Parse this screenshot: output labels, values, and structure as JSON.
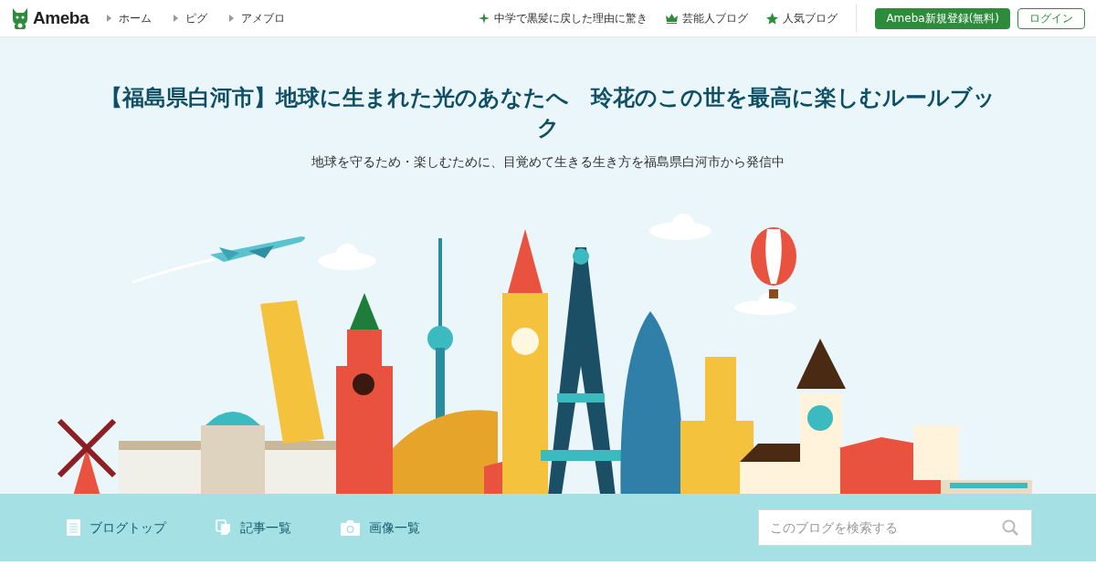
{
  "header": {
    "logo": "Ameba",
    "nav_links": [
      "ホーム",
      "ピグ",
      "アメブロ"
    ],
    "promo_links": [
      {
        "kind": "sparkle",
        "label": "中学で黒髪に戻した理由に驚き"
      },
      {
        "kind": "crown",
        "label": "芸能人ブログ"
      },
      {
        "kind": "star",
        "label": "人気ブログ"
      }
    ],
    "signup_button": "Ameba新規登録(無料)",
    "login_button": "ログイン"
  },
  "blog": {
    "title": "【福島県白河市】地球に生まれた光のあなたへ　玲花のこの世を最高に楽しむルールブック",
    "description": "地球を守るため・楽しむために、目覚めて生きる生き方を福島県白河市から発信中"
  },
  "blog_nav": {
    "items": [
      {
        "kind": "document",
        "label": "ブログトップ"
      },
      {
        "kind": "pages",
        "label": "記事一覧"
      },
      {
        "kind": "camera",
        "label": "画像一覧"
      }
    ],
    "search": {
      "placeholder": "このブログを検索する"
    }
  }
}
